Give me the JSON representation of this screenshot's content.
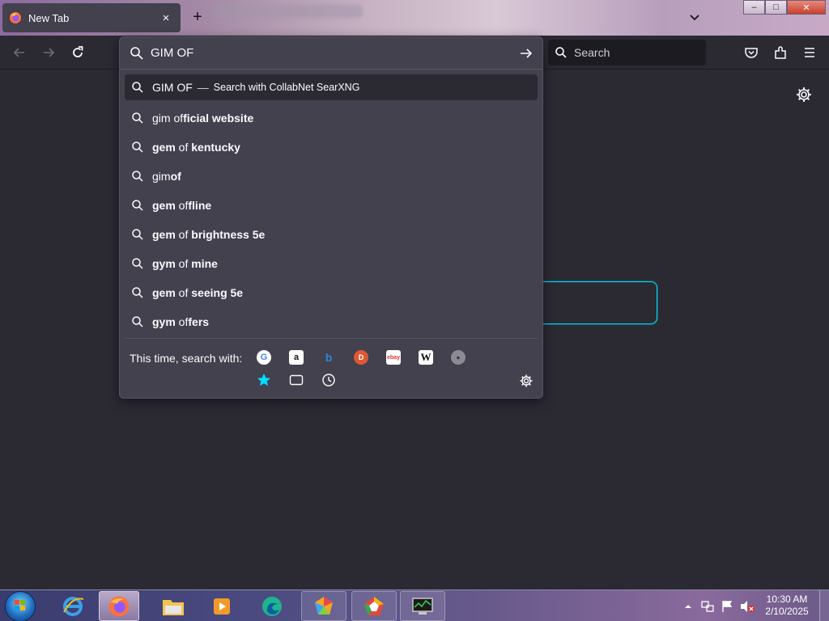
{
  "tabstrip": {
    "tab_title": "New Tab",
    "tab_close": "×",
    "new_tab": "+"
  },
  "window": {
    "minimize": "–",
    "maximize": "□",
    "close": "✕"
  },
  "toolbar": {
    "search_placeholder": "Search"
  },
  "urlbar": {
    "value": "GIM OF",
    "first_result": {
      "query": "GIM OF",
      "separator": "—",
      "action": "Search with CollabNet SearXNG"
    },
    "suggestions": [
      {
        "plain": "gim of",
        "bold": "ficial website",
        "bold_first": false
      },
      {
        "bold_prefix": "gem",
        "plain": " of ",
        "bold": "kentucky"
      },
      {
        "plain": "gim",
        "bold": "of"
      },
      {
        "bold_prefix": "gem",
        "plain": " of",
        "bold": "fline"
      },
      {
        "bold_prefix": "gem",
        "plain": " of ",
        "bold": "brightness 5e"
      },
      {
        "bold_prefix": "gym",
        "plain": " of ",
        "bold": "mine"
      },
      {
        "bold_prefix": "gem",
        "plain": " of ",
        "bold": "seeing 5e"
      },
      {
        "bold_prefix": "gym",
        "plain": " of",
        "bold": "fers"
      }
    ],
    "one_off_label": "This time, search with:",
    "engines": [
      "google-icon",
      "amazon-icon",
      "bing-icon",
      "duckduckgo-icon",
      "ebay-icon",
      "wikipedia-icon",
      "searxng-icon"
    ],
    "modes": [
      "bookmarks-icon",
      "tabs-icon",
      "history-icon"
    ]
  },
  "taskbar": {
    "time": "10:30 AM",
    "date": "2/10/2025"
  },
  "colors": {
    "accent": "#00ddff",
    "bg": "#2b2a33",
    "popup": "#42414d"
  }
}
